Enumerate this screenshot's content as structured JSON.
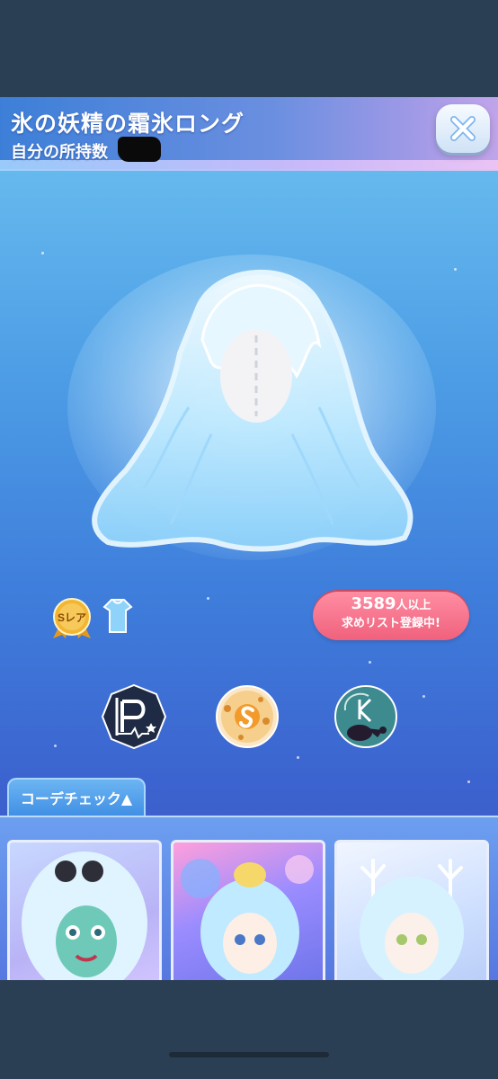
{
  "item": {
    "title": "氷の妖精の霜氷ロング",
    "owned_label": "自分の所持数"
  },
  "close_button": {
    "icon": "close-icon"
  },
  "rarity": {
    "badge_label": "Sレア",
    "category_icon": "dress-icon"
  },
  "wishlist": {
    "count": "3589",
    "count_unit": "人以上",
    "status": "求めリスト登録中!"
  },
  "brand_icons": [
    "p-brand-icon",
    "s-brand-icon",
    "k-brand-icon"
  ],
  "code_check": {
    "tab_label": "コーデチェック▲"
  },
  "colors": {
    "wishlist_pink": "#f0617d",
    "panel_blue": "#4e9fe6",
    "badge_gold": "#f2b632"
  }
}
